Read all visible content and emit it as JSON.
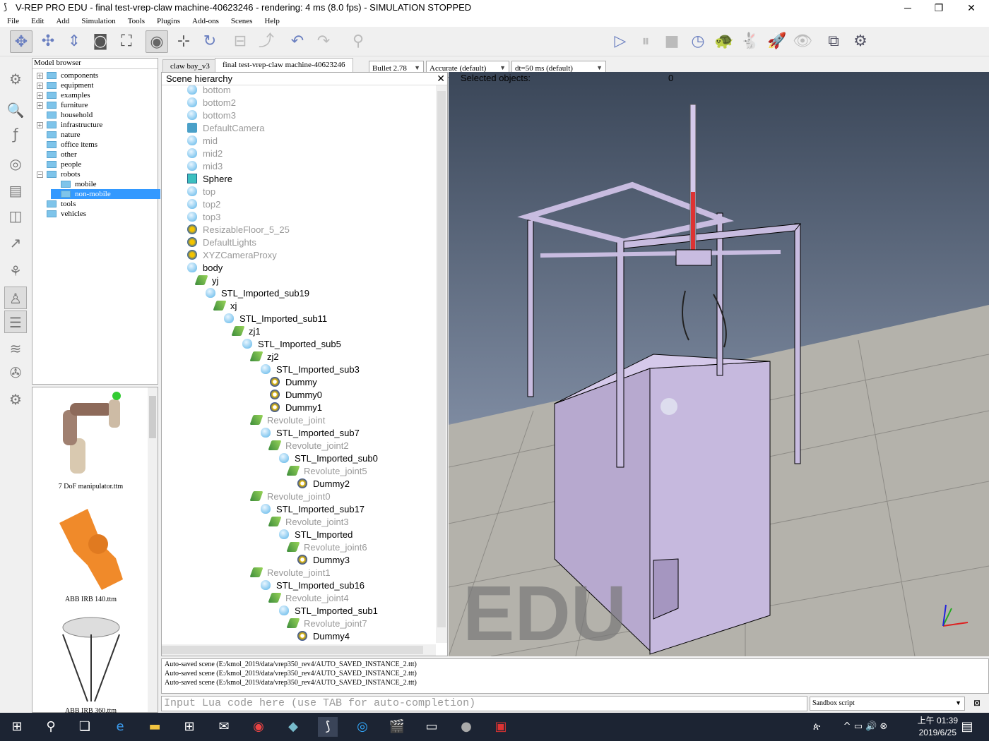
{
  "window": {
    "title": "V-REP PRO EDU - final test-vrep-claw machine-40623246 - rendering: 4 ms (8.0 fps) - SIMULATION STOPPED",
    "minimize": "─",
    "maximize": "❐",
    "close": "✕"
  },
  "menu": [
    "File",
    "Edit",
    "Add",
    "Simulation",
    "Tools",
    "Plugins",
    "Add-ons",
    "Scenes",
    "Help"
  ],
  "toolbar": {
    "engine": "Bullet 2.78",
    "accuracy": "Accurate (default)",
    "timestep": "dt=50 ms (default)"
  },
  "model_browser": {
    "title": "Model browser",
    "items": [
      {
        "label": "components",
        "expander": "+",
        "depth": 0
      },
      {
        "label": "equipment",
        "expander": "+",
        "depth": 0
      },
      {
        "label": "examples",
        "expander": "+",
        "depth": 0
      },
      {
        "label": "furniture",
        "expander": "+",
        "depth": 0
      },
      {
        "label": "household",
        "expander": "",
        "depth": 0
      },
      {
        "label": "infrastructure",
        "expander": "+",
        "depth": 0
      },
      {
        "label": "nature",
        "expander": "",
        "depth": 0
      },
      {
        "label": "office items",
        "expander": "",
        "depth": 0
      },
      {
        "label": "other",
        "expander": "",
        "depth": 0
      },
      {
        "label": "people",
        "expander": "",
        "depth": 0
      },
      {
        "label": "robots",
        "expander": "−",
        "depth": 0
      },
      {
        "label": "mobile",
        "expander": "",
        "depth": 1
      },
      {
        "label": "non-mobile",
        "expander": "",
        "depth": 1,
        "selected": true
      },
      {
        "label": "tools",
        "expander": "",
        "depth": 0
      },
      {
        "label": "vehicles",
        "expander": "",
        "depth": 0
      }
    ],
    "thumbnails": [
      "7 DoF manipulator.ttm",
      "ABB IRB 140.ttm",
      "ABB IRB 360.ttm"
    ]
  },
  "tabs": [
    "claw bay_v3",
    "final test-vrep-claw machine-40623246"
  ],
  "hierarchy": {
    "title": "Scene hierarchy",
    "rows": [
      {
        "n": "bottom",
        "d": 0,
        "i": "shape",
        "g": true
      },
      {
        "n": "bottom2",
        "d": 0,
        "i": "shape",
        "g": true
      },
      {
        "n": "bottom3",
        "d": 0,
        "i": "shape",
        "g": true
      },
      {
        "n": "DefaultCamera",
        "d": 0,
        "i": "cam",
        "g": true
      },
      {
        "n": "mid",
        "d": 0,
        "i": "shape",
        "g": true
      },
      {
        "n": "mid2",
        "d": 0,
        "i": "shape",
        "g": true
      },
      {
        "n": "mid3",
        "d": 0,
        "i": "shape",
        "g": true
      },
      {
        "n": "Sphere",
        "d": 0,
        "i": "cube",
        "g": false
      },
      {
        "n": "top",
        "d": 0,
        "i": "shape",
        "g": true
      },
      {
        "n": "top2",
        "d": 0,
        "i": "shape",
        "g": true
      },
      {
        "n": "top3",
        "d": 0,
        "i": "shape",
        "g": true
      },
      {
        "n": "ResizableFloor_5_25",
        "d": 0,
        "i": "model",
        "g": true
      },
      {
        "n": "DefaultLights",
        "d": 0,
        "i": "model",
        "g": true
      },
      {
        "n": "XYZCameraProxy",
        "d": 0,
        "i": "model",
        "g": true
      },
      {
        "n": "body",
        "d": 0,
        "i": "shape",
        "g": false
      },
      {
        "n": "yj",
        "d": 1,
        "i": "joint",
        "g": false
      },
      {
        "n": "STL_Imported_sub19",
        "d": 2,
        "i": "shape",
        "g": false
      },
      {
        "n": "xj",
        "d": 3,
        "i": "joint",
        "g": false
      },
      {
        "n": "STL_Imported_sub11",
        "d": 4,
        "i": "shape",
        "g": false
      },
      {
        "n": "zj1",
        "d": 5,
        "i": "joint",
        "g": false
      },
      {
        "n": "STL_Imported_sub5",
        "d": 6,
        "i": "shape",
        "g": false
      },
      {
        "n": "zj2",
        "d": 7,
        "i": "joint",
        "g": false
      },
      {
        "n": "STL_Imported_sub3",
        "d": 8,
        "i": "shape",
        "g": false
      },
      {
        "n": "Dummy",
        "d": 9,
        "i": "dummy",
        "g": false
      },
      {
        "n": "Dummy0",
        "d": 9,
        "i": "dummy",
        "g": false
      },
      {
        "n": "Dummy1",
        "d": 9,
        "i": "dummy",
        "g": false
      },
      {
        "n": "Revolute_joint",
        "d": 7,
        "i": "joint",
        "g": true
      },
      {
        "n": "STL_Imported_sub7",
        "d": 8,
        "i": "shape",
        "g": false
      },
      {
        "n": "Revolute_joint2",
        "d": 9,
        "i": "joint",
        "g": true
      },
      {
        "n": "STL_Imported_sub0",
        "d": 10,
        "i": "shape",
        "g": false
      },
      {
        "n": "Revolute_joint5",
        "d": 11,
        "i": "joint",
        "g": true
      },
      {
        "n": "Dummy2",
        "d": 12,
        "i": "dummy",
        "g": false
      },
      {
        "n": "Revolute_joint0",
        "d": 7,
        "i": "joint",
        "g": true
      },
      {
        "n": "STL_Imported_sub17",
        "d": 8,
        "i": "shape",
        "g": false
      },
      {
        "n": "Revolute_joint3",
        "d": 9,
        "i": "joint",
        "g": true
      },
      {
        "n": "STL_Imported",
        "d": 10,
        "i": "shape",
        "g": false
      },
      {
        "n": "Revolute_joint6",
        "d": 11,
        "i": "joint",
        "g": true
      },
      {
        "n": "Dummy3",
        "d": 12,
        "i": "dummy",
        "g": false
      },
      {
        "n": "Revolute_joint1",
        "d": 7,
        "i": "joint",
        "g": true
      },
      {
        "n": "STL_Imported_sub16",
        "d": 8,
        "i": "shape",
        "g": false
      },
      {
        "n": "Revolute_joint4",
        "d": 9,
        "i": "joint",
        "g": true
      },
      {
        "n": "STL_Imported_sub1",
        "d": 10,
        "i": "shape",
        "g": false
      },
      {
        "n": "Revolute_joint7",
        "d": 11,
        "i": "joint",
        "g": true
      },
      {
        "n": "Dummy4",
        "d": 12,
        "i": "dummy",
        "g": false
      }
    ]
  },
  "viewport": {
    "selected_label": "Selected objects:",
    "selected_count": "0",
    "watermark": "EDU"
  },
  "log": [
    "Auto-saved scene (E:/kmol_2019/data/vrep350_rev4/AUTO_SAVED_INSTANCE_2.ttt)",
    "Auto-saved scene (E:/kmol_2019/data/vrep350_rev4/AUTO_SAVED_INSTANCE_2.ttt)",
    "Auto-saved scene (E:/kmol_2019/data/vrep350_rev4/AUTO_SAVED_INSTANCE_2.ttt)"
  ],
  "lua_input": {
    "placeholder": "Input Lua code here (use TAB for auto-completion)"
  },
  "script_selector": "Sandbox script",
  "taskbar": {
    "time": "上午 01:39",
    "date": "2019/6/25"
  }
}
